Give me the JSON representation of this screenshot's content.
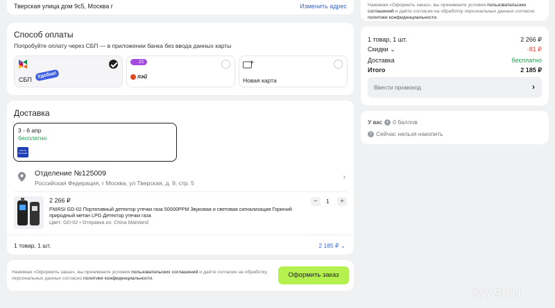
{
  "address": {
    "text": "Тверская улица дом 9с5, Москва г",
    "change_label": "Изменить адрес"
  },
  "payment": {
    "title": "Способ оплаты",
    "subtitle": "Попробуйте оплату через СБП — в приложении банка без ввода данных карты",
    "methods": [
      {
        "label": "СБП",
        "badge": "Удобно!",
        "selected": true
      },
      {
        "label": "пэй",
        "badge": "21",
        "selected": false
      },
      {
        "label": "Новая карта",
        "badge": "",
        "selected": false
      }
    ]
  },
  "delivery": {
    "title": "Доставка",
    "option": {
      "dates": "3 - 6 апр",
      "price": "бесплатно",
      "carrier_logo_text": "ПОЧТА РОССИИ"
    },
    "pickup": {
      "name": "Отделение №125009",
      "address": "Российская Федерация, г Москва, ул Тверская, д. 9, стр. 5"
    },
    "item": {
      "price": "2 266 ₽",
      "title_line1": "FNIRSI GD-02 Портативный детектор утечки газа 50000PPM Звуковая и световая сигнализация Горючий",
      "title_line2": "природный метан LPG Детектор утечки газа",
      "meta": "Цвет: GD-02 • Отправка из: China Mainland",
      "quantity": "1",
      "minus": "−",
      "plus": "+"
    },
    "footer": {
      "count": "1 товар, 1 шт.",
      "total": "2 185 ₽"
    }
  },
  "checkout": {
    "legal_prefix": "Нажимая «Оформить заказ», вы принимаете условия ",
    "legal_link1": "пользовательских соглашений",
    "legal_mid": " и даёте согласие на обработку персональных данных согласно ",
    "legal_link2": "политике конфиденциальности",
    "legal_end": ".",
    "button": "Оформить заказ"
  },
  "summary": {
    "legal_prefix": "Нажимая «Оформить заказ», вы принимаете условия ",
    "legal_link1": "пользовательских соглашений",
    "legal_mid": " и даёте согласие на обработку персональных данных согласно ",
    "legal_link2": "политике конфиденциальности",
    "legal_end": ".",
    "items_label": "1 товар, 1 шт.",
    "items_value": "2 266 ₽",
    "discount_label": "Скидки",
    "discount_value": "-81 ₽",
    "delivery_label": "Доставка",
    "delivery_value": "бесплатно",
    "total_label": "Итого",
    "total_value": "2 185 ₽",
    "promo_placeholder": "Ввести промокод"
  },
  "points": {
    "balance_prefix": "У вас",
    "balance_value": "0 баллов",
    "note": "Сейчас нельзя накопить"
  },
  "watermark": "MYSKU",
  "colors": {
    "accent_green": "#b4f04e",
    "link_blue": "#3b67c9",
    "discount_red": "#e0443a",
    "free_green": "#19a34a"
  }
}
